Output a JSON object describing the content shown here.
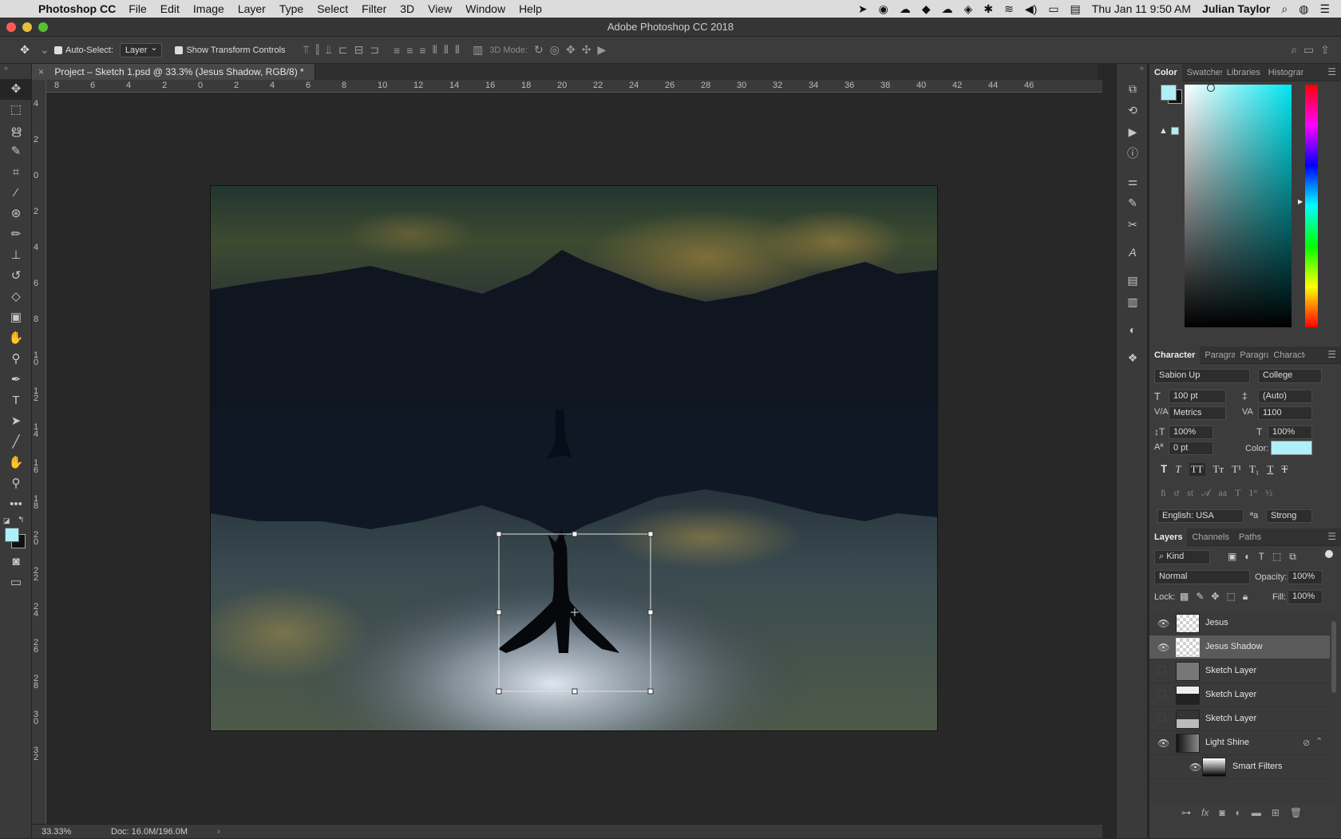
{
  "menubar": {
    "app": "Photoshop CC",
    "items": [
      "File",
      "Edit",
      "Image",
      "Layer",
      "Type",
      "Select",
      "Filter",
      "3D",
      "View",
      "Window",
      "Help"
    ],
    "clock": "Thu Jan 11  9:50 AM",
    "user": "Julian Taylor"
  },
  "window": {
    "title": "Adobe Photoshop CC 2018"
  },
  "options": {
    "auto_select_label": "Auto-Select:",
    "auto_select_value": "Layer",
    "show_transform_label": "Show Transform Controls",
    "mode_3d": "3D Mode:"
  },
  "document": {
    "tab_title": "Project – Sketch 1.psd @ 33.3% (Jesus Shadow, RGB/8) *",
    "zoom": "33.33%",
    "doc_info": "Doc: 16.0M/196.0M"
  },
  "rulers": {
    "h": [
      "8",
      "6",
      "4",
      "2",
      "0",
      "2",
      "4",
      "6",
      "8",
      "10",
      "12",
      "14",
      "16",
      "18",
      "20",
      "22",
      "24",
      "26",
      "28",
      "30",
      "32",
      "34",
      "36",
      "38",
      "40",
      "42",
      "44",
      "46"
    ],
    "v": [
      "4",
      "2",
      "0",
      "2",
      "4",
      "6",
      "8",
      "1 0",
      "1 2",
      "1 4",
      "1 6",
      "1 8",
      "2 0",
      "2 2",
      "2 4",
      "2 6",
      "2 8",
      "3 0",
      "3 2"
    ]
  },
  "color_panel": {
    "tabs": [
      "Color",
      "Swatches",
      "Libraries",
      "Histogram"
    ],
    "foreground": "#aef0f7",
    "background": "#111111"
  },
  "character_panel": {
    "tabs": [
      "Character",
      "Paragraph",
      "Paragraph",
      "Character"
    ],
    "font_family": "Sabion Up",
    "font_style": "College",
    "size": "100 pt",
    "leading": "(Auto)",
    "kerning": "Metrics",
    "tracking": "1100",
    "v_scale": "100%",
    "h_scale": "100%",
    "baseline": "0 pt",
    "color_label": "Color:",
    "color": "#aef0f7",
    "language": "English: USA",
    "antialias": "Strong",
    "aa_icon": "ªa"
  },
  "layers_panel": {
    "tabs": [
      "Layers",
      "Channels",
      "Paths"
    ],
    "filter": "Kind",
    "blend": "Normal",
    "opacity_label": "Opacity:",
    "opacity": "100%",
    "lock_label": "Lock:",
    "fill_label": "Fill:",
    "fill": "100%",
    "layers": [
      {
        "name": "Jesus",
        "visible": true
      },
      {
        "name": "Jesus Shadow",
        "visible": true
      },
      {
        "name": "Sketch Layer",
        "visible": false
      },
      {
        "name": "Sketch Layer",
        "visible": false
      },
      {
        "name": "Sketch Layer",
        "visible": false
      },
      {
        "name": "Light Shine",
        "visible": true
      },
      {
        "name": "Smart Filters",
        "visible": true
      }
    ]
  }
}
